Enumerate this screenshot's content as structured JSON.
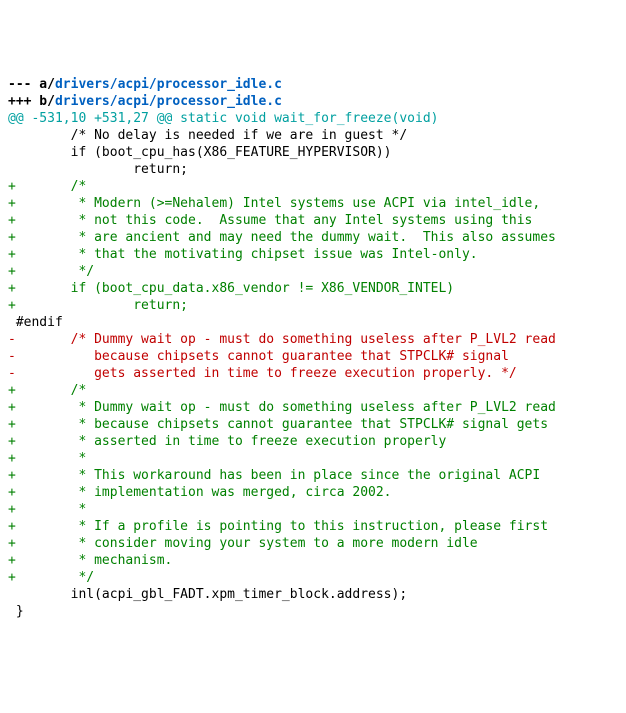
{
  "diff": {
    "minus_prefix": "--- a/",
    "plus_prefix": "+++ b/",
    "path": "drivers/acpi/processor_idle.c",
    "hunk": "@@ -531,10 +531,27 @@ static void wait_for_freeze(void)",
    "ctx1": "        /* No delay is needed if we are in guest */",
    "ctx2": "        if (boot_cpu_has(X86_FEATURE_HYPERVISOR))",
    "ctx3": "                return;",
    "add1": "+       /*",
    "add2": "+        * Modern (>=Nehalem) Intel systems use ACPI via intel_idle,",
    "add3": "+        * not this code.  Assume that any Intel systems using this",
    "add4": "+        * are ancient and may need the dummy wait.  This also assumes",
    "add5": "+        * that the motivating chipset issue was Intel-only.",
    "add6": "+        */",
    "add7": "+       if (boot_cpu_data.x86_vendor != X86_VENDOR_INTEL)",
    "add8": "+               return;",
    "ctx4": " #endif",
    "del1": "-       /* Dummy wait op - must do something useless after P_LVL2 read",
    "del2": "-          because chipsets cannot guarantee that STPCLK# signal",
    "del3": "-          gets asserted in time to freeze execution properly. */",
    "add9": "+       /*",
    "add10": "+        * Dummy wait op - must do something useless after P_LVL2 read",
    "add11": "+        * because chipsets cannot guarantee that STPCLK# signal gets",
    "add12": "+        * asserted in time to freeze execution properly",
    "add13": "+        *",
    "add14": "+        * This workaround has been in place since the original ACPI",
    "add15": "+        * implementation was merged, circa 2002.",
    "add16": "+        *",
    "add17": "+        * If a profile is pointing to this instruction, please first",
    "add18": "+        * consider moving your system to a more modern idle",
    "add19": "+        * mechanism.",
    "add20": "+        */",
    "ctx5": "        inl(acpi_gbl_FADT.xpm_timer_block.address);",
    "ctx6": " }"
  }
}
